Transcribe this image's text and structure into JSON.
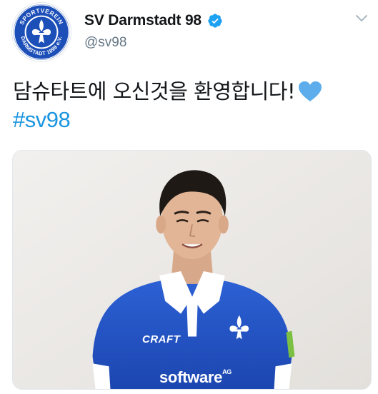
{
  "account": {
    "display_name": "SV Darmstadt 98",
    "handle": "@sv98",
    "verified": true,
    "avatar_icon": "sv-darmstadt-lily-crest",
    "avatar_text": "SPORTVEREIN DARMSTADT 1898 e.V."
  },
  "tweet": {
    "text": "담슈타트에 오신것을 환영합니다!",
    "emoji": "blue-heart",
    "hashtag": "#sv98"
  },
  "media": {
    "description": "player-photo",
    "kit_brand": "CRAFT",
    "sponsor": "software",
    "sponsor_suffix": "AG"
  },
  "colors": {
    "brand_blue": "#1d4fb8",
    "link_blue": "#1b95e0",
    "verified_blue": "#1da1f2",
    "heart_blue": "#5dadec",
    "text_primary": "#14171a",
    "text_secondary": "#657786"
  },
  "icons": {
    "verified": "verified-badge-icon",
    "menu": "chevron-down-icon"
  }
}
